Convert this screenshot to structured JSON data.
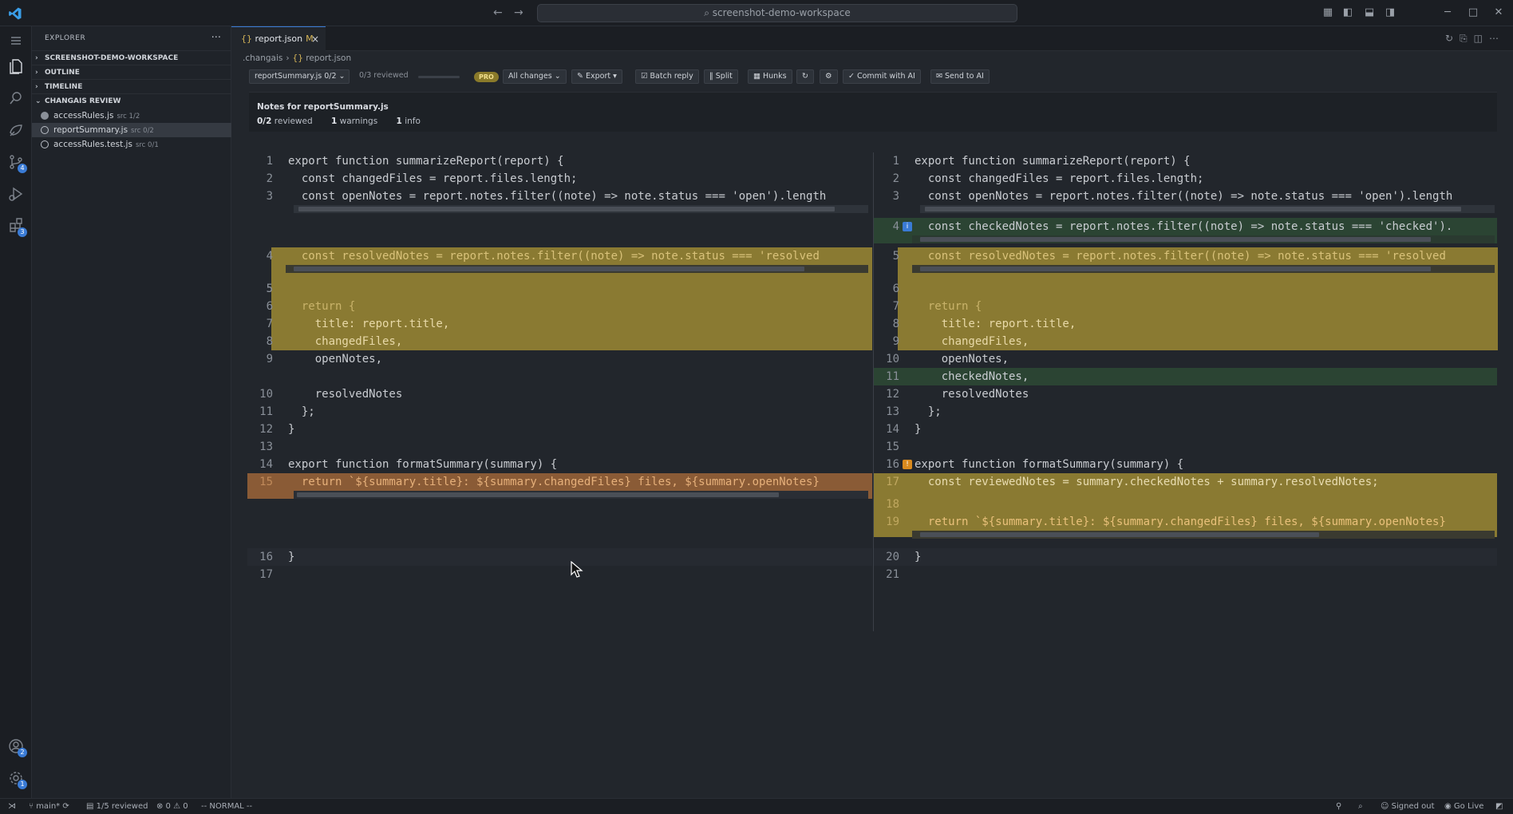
{
  "titlebar": {
    "back_icon": "arrow-left-icon",
    "forward_icon": "arrow-right-icon",
    "search_text": "screenshot-demo-workspace"
  },
  "activity_bar": {
    "items": [
      {
        "icon": "explorer-icon",
        "badge": ""
      },
      {
        "icon": "search-icon",
        "badge": ""
      },
      {
        "icon": "changais-icon",
        "badge": ""
      },
      {
        "icon": "source-control-icon",
        "badge": "4"
      },
      {
        "icon": "run-debug-icon",
        "badge": ""
      },
      {
        "icon": "extensions-icon",
        "badge": "3"
      }
    ],
    "bottom": [
      {
        "icon": "account-icon",
        "badge": "2"
      },
      {
        "icon": "settings-icon",
        "badge": "1"
      }
    ]
  },
  "sidebar": {
    "title": "EXPLORER",
    "more": "···",
    "sections": {
      "workspace": "SCREENSHOT-DEMO-WORKSPACE",
      "outline": "OUTLINE",
      "timeline": "TIMELINE",
      "review": "CHANGAIS REVIEW"
    },
    "files": [
      {
        "name": "accessRules.js",
        "meta": "src 1/2"
      },
      {
        "name": "reportSummary.js",
        "meta": "src 0/2"
      },
      {
        "name": "accessRules.test.js",
        "meta": "src 0/1"
      }
    ]
  },
  "editor": {
    "tab": {
      "name": "report.json",
      "modified": "M",
      "close": "×"
    },
    "breadcrumb": [
      ".changais",
      "report.json"
    ],
    "toolbar": {
      "file_select": "reportSummary.js 0/2",
      "reviewed": "0/3 reviewed",
      "progress": 0,
      "pro": "PRO",
      "changes_select": "All changes",
      "export": "✎ Export ▾",
      "batch_reply": "☑ Batch reply",
      "split": "‖ Split",
      "hunks": "▦ Hunks",
      "refresh": "↻",
      "settings": "⚙",
      "commit": "✓ Commit with AI",
      "send": "✉ Send to AI"
    },
    "notes": {
      "title": "Notes for reportSummary.js",
      "reviewed": "0/2",
      "reviewed_label": "reviewed",
      "warnings": "1",
      "warnings_label": "warnings",
      "info": "1",
      "info_label": "info"
    }
  },
  "diff": {
    "left": {
      "lines": [
        {
          "n": "1",
          "code": "export function summarizeReport(report) {"
        },
        {
          "n": "2",
          "code": "  const changedFiles = report.files.length;"
        },
        {
          "n": "3",
          "code": "  const openNotes = report.notes.filter((note) => note.status === 'open').length"
        },
        {
          "n": "4",
          "code": "  const resolvedNotes = report.notes.filter((note) => note.status === 'resolved"
        },
        {
          "n": "5",
          "code": ""
        },
        {
          "n": "6",
          "code": "  return {"
        },
        {
          "n": "7",
          "code": "    title: report.title,"
        },
        {
          "n": "8",
          "code": "    changedFiles,"
        },
        {
          "n": "9",
          "code": "    openNotes,"
        },
        {
          "n": "10",
          "code": "    resolvedNotes"
        },
        {
          "n": "11",
          "code": "  };"
        },
        {
          "n": "12",
          "code": "}"
        },
        {
          "n": "13",
          "code": ""
        },
        {
          "n": "14",
          "code": "export function formatSummary(summary) {"
        },
        {
          "n": "15",
          "code": "  return `${summary.title}: ${summary.changedFiles} files, ${summary.openNotes}"
        },
        {
          "n": "16",
          "code": "}"
        },
        {
          "n": "17",
          "code": ""
        }
      ]
    },
    "right": {
      "lines": [
        {
          "n": "1",
          "code": "export function summarizeReport(report) {"
        },
        {
          "n": "2",
          "code": "  const changedFiles = report.files.length;"
        },
        {
          "n": "3",
          "code": "  const openNotes = report.notes.filter((note) => note.status === 'open').length"
        },
        {
          "n": "4",
          "code": "  const checkedNotes = report.notes.filter((note) => note.status === 'checked')."
        },
        {
          "n": "5",
          "code": "  const resolvedNotes = report.notes.filter((note) => note.status === 'resolved"
        },
        {
          "n": "6",
          "code": ""
        },
        {
          "n": "7",
          "code": "  return {"
        },
        {
          "n": "8",
          "code": "    title: report.title,"
        },
        {
          "n": "9",
          "code": "    changedFiles,"
        },
        {
          "n": "10",
          "code": "    openNotes,"
        },
        {
          "n": "11",
          "code": "    checkedNotes,"
        },
        {
          "n": "12",
          "code": "    resolvedNotes"
        },
        {
          "n": "13",
          "code": "  };"
        },
        {
          "n": "14",
          "code": "}"
        },
        {
          "n": "15",
          "code": ""
        },
        {
          "n": "16",
          "code": "export function formatSummary(summary) {"
        },
        {
          "n": "17",
          "code": "  const reviewedNotes = summary.checkedNotes + summary.resolvedNotes;"
        },
        {
          "n": "18",
          "code": ""
        },
        {
          "n": "19",
          "code": "  return `${summary.title}: ${summary.changedFiles} files, ${summary.openNotes}"
        },
        {
          "n": "20",
          "code": "}"
        },
        {
          "n": "21",
          "code": ""
        }
      ],
      "info_marker": "i",
      "warning_marker": "!"
    }
  },
  "statusbar": {
    "branch": "main*",
    "reviewed": "1/5 reviewed",
    "problems": "⊗ 0 ⚠ 0",
    "mode": "-- NORMAL --",
    "signed_out": "Signed out",
    "go_live": "Go Live"
  },
  "colors": {
    "accent": "#3a7bd5",
    "hunk": "#8a7a32",
    "added": "#2b4433",
    "removed": "#8a5b36"
  }
}
